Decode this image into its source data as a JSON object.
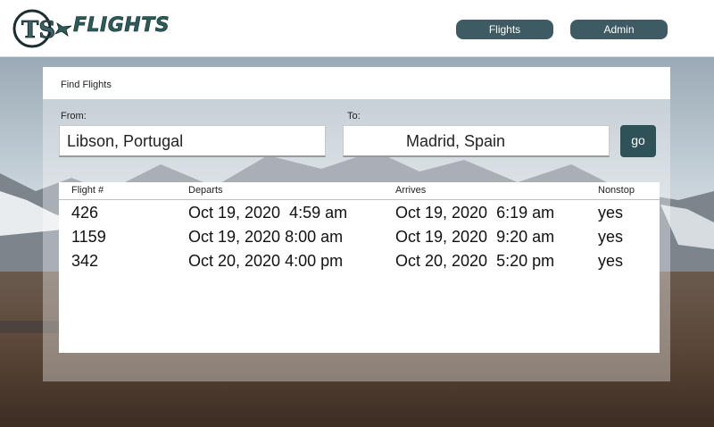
{
  "brand": {
    "name": "FLIGHTS",
    "logo_letters": "TS",
    "logo_icon": "plane-icon"
  },
  "nav": [
    {
      "label": "Flights"
    },
    {
      "label": "Admin"
    }
  ],
  "search": {
    "title": "Find Flights",
    "from_label": "From:",
    "from_value": "Libson, Portugal",
    "to_label": "To:",
    "to_value": "Madrid, Spain",
    "go_label": "go"
  },
  "results": {
    "headers": [
      "Flight #",
      "Departs",
      "Arrives",
      "Nonstop"
    ],
    "rows": [
      [
        "426",
        "Oct 19, 2020  4:59 am",
        "Oct 19, 2020  6:19 am",
        "yes"
      ],
      [
        "1159",
        "Oct 19, 2020 8:00 am",
        "Oct 19, 2020  9:20 am",
        "yes"
      ],
      [
        "342",
        "Oct 20, 2020 4:00 pm",
        "Oct 20, 2020  5:20 pm",
        "yes"
      ]
    ]
  },
  "colors": {
    "brand": "#2f5a5a",
    "button": "#3e5a62",
    "go_button": "#2f5158"
  }
}
